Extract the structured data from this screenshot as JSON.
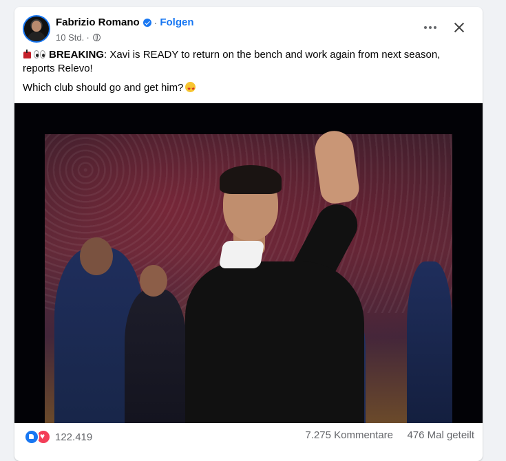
{
  "post": {
    "author": "Fabrizio Romano",
    "separator": "·",
    "follow_label": "Folgen",
    "time": "10 Std.",
    "privacy_icon": "globe-icon",
    "verified_color": "#1877f2",
    "text_line1_label": "BREAKING",
    "text_line1_rest": ": Xavi is READY to return on the bench and work again from next season, reports Relevo!",
    "text_line2": "Which club should go and get him?"
  },
  "engagement": {
    "reaction_count": "122.419",
    "comments": "7.275 Kommentare",
    "shares": "476 Mal geteilt"
  },
  "icons": {
    "more": "more-options-icon",
    "close": "close-icon",
    "like": "like-reaction-icon",
    "love": "love-reaction-icon"
  }
}
